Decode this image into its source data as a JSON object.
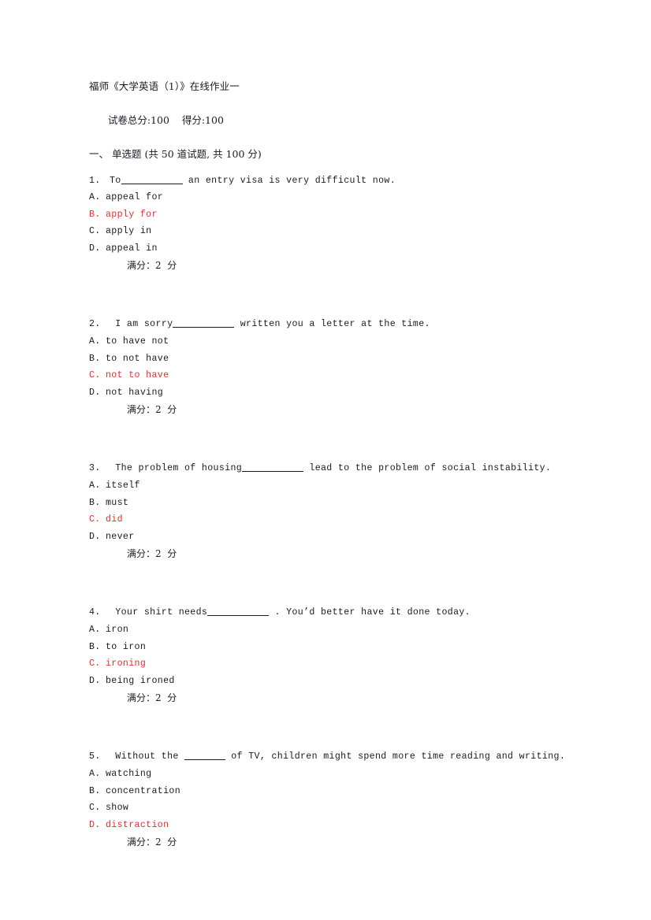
{
  "document": {
    "title": "福师《大学英语（1）》在线作业一",
    "total_score_label": "试卷总分:100",
    "earned_score_label": "得分:100",
    "section_heading": "一、 单选题 (共 50 道试题, 共 100 分)"
  },
  "theme": {
    "text_color": "#1a1a24",
    "correct_answer_color": "#ee2b2b",
    "page_background": "#ffffff"
  },
  "questions": [
    {
      "number": "1.",
      "stem_before": "To",
      "blank": "long",
      "stem_after": " an entry visa is very difficult now.",
      "options": [
        {
          "letter": "A.",
          "text": "appeal for",
          "correct": false
        },
        {
          "letter": "B.",
          "text": "apply for",
          "correct": true
        },
        {
          "letter": "C.",
          "text": "apply in",
          "correct": false
        },
        {
          "letter": "D.",
          "text": "appeal in",
          "correct": false
        }
      ],
      "points_label": "满分：2  分"
    },
    {
      "number": "2.",
      "stem_before": " I am sorry",
      "blank": "long",
      "stem_after": " written you a letter at the time.",
      "options": [
        {
          "letter": "A.",
          "text": "to have not",
          "correct": false
        },
        {
          "letter": "B.",
          "text": "to not have",
          "correct": false
        },
        {
          "letter": "C.",
          "text": "not to have",
          "correct": true
        },
        {
          "letter": "D.",
          "text": "not having",
          "correct": false
        }
      ],
      "points_label": "满分：2  分"
    },
    {
      "number": "3.",
      "stem_before": " The problem of housing",
      "blank": "long",
      "stem_after": " lead to the problem of social instability.",
      "options": [
        {
          "letter": "A.",
          "text": "itself",
          "correct": false
        },
        {
          "letter": "B.",
          "text": "must",
          "correct": false
        },
        {
          "letter": "C.",
          "text": "did",
          "correct": true
        },
        {
          "letter": "D.",
          "text": "never",
          "correct": false
        }
      ],
      "points_label": "满分：2  分"
    },
    {
      "number": "4.",
      "stem_before": " Your shirt needs",
      "blank": "long",
      "stem_after": " . You’d better have it done today.",
      "options": [
        {
          "letter": "A.",
          "text": "iron",
          "correct": false
        },
        {
          "letter": "B.",
          "text": "to iron",
          "correct": false
        },
        {
          "letter": "C.",
          "text": "ironing",
          "correct": true
        },
        {
          "letter": "D.",
          "text": "being ironed",
          "correct": false
        }
      ],
      "points_label": "满分：2  分"
    },
    {
      "number": "5.",
      "stem_before": " Without the ",
      "blank": "short",
      "stem_after": " of TV, children might spend more time reading and writing.",
      "options": [
        {
          "letter": "A.",
          "text": "watching",
          "correct": false
        },
        {
          "letter": "B.",
          "text": "concentration",
          "correct": false
        },
        {
          "letter": "C.",
          "text": "show",
          "correct": false
        },
        {
          "letter": "D.",
          "text": "distraction",
          "correct": true
        }
      ],
      "points_label": "满分：2  分"
    }
  ]
}
